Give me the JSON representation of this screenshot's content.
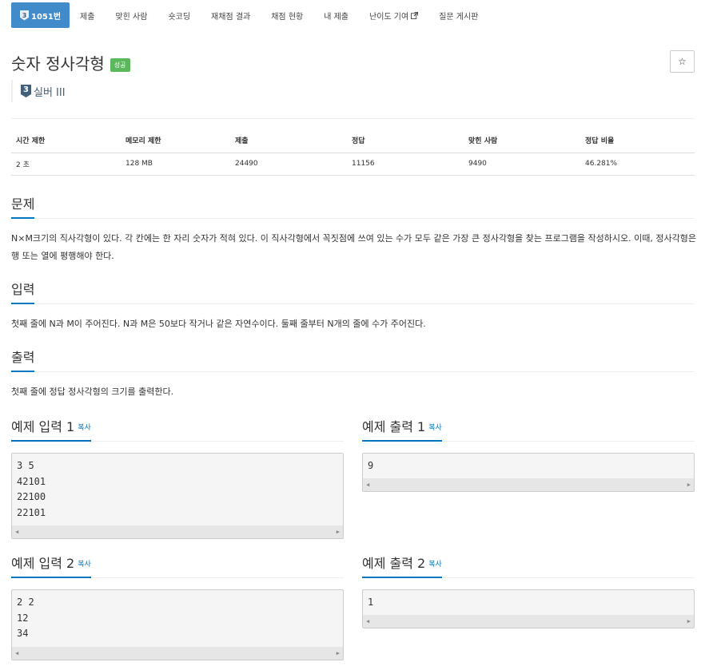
{
  "nav": {
    "tabs": [
      {
        "label": "1051번",
        "tier": "3"
      },
      {
        "label": "제출"
      },
      {
        "label": "맞힌 사람"
      },
      {
        "label": "숏코딩"
      },
      {
        "label": "재채점 결과"
      },
      {
        "label": "채점 현황"
      },
      {
        "label": "내 제출"
      },
      {
        "label": "난이도 기여"
      },
      {
        "label": "질문 게시판"
      }
    ]
  },
  "problem": {
    "title": "숫자 정사각형",
    "badge": "성공",
    "tier_number": "3",
    "tier_label": "실버 III",
    "star": "☆"
  },
  "info": {
    "headers": [
      "시간 제한",
      "메모리 제한",
      "제출",
      "정답",
      "맞힌 사람",
      "정답 비율"
    ],
    "values": [
      "2 초",
      "128 MB",
      "24490",
      "11156",
      "9490",
      "46.281%"
    ]
  },
  "sections": {
    "problem_title": "문제",
    "problem_text": "N×M크기의 직사각형이 있다. 각 칸에는 한 자리 숫자가 적혀 있다. 이 직사각형에서 꼭짓점에 쓰여 있는 수가 모두 같은 가장 큰 정사각형을 찾는 프로그램을 작성하시오. 이때, 정사각형은 행 또는 열에 평행해야 한다.",
    "input_title": "입력",
    "input_text": "첫째 줄에 N과 M이 주어진다. N과 M은 50보다 작거나 같은 자연수이다. 둘째 줄부터 N개의 줄에 수가 주어진다.",
    "output_title": "출력",
    "output_text": "첫째 줄에 정답 정사각형의 크기를 출력한다."
  },
  "samples": {
    "copy_label": "복사",
    "input1_title": "예제 입력 1",
    "input1_lines": [
      "3 5",
      "42101",
      "22100",
      "22101"
    ],
    "output1_title": "예제 출력 1",
    "output1_lines": [
      "9"
    ],
    "input2_title": "예제 입력 2",
    "input2_lines": [
      "2 2",
      "12",
      "34"
    ],
    "output2_title": "예제 출력 2",
    "output2_lines": [
      "1"
    ],
    "scroll_left": "◀",
    "scroll_right": "▶"
  }
}
